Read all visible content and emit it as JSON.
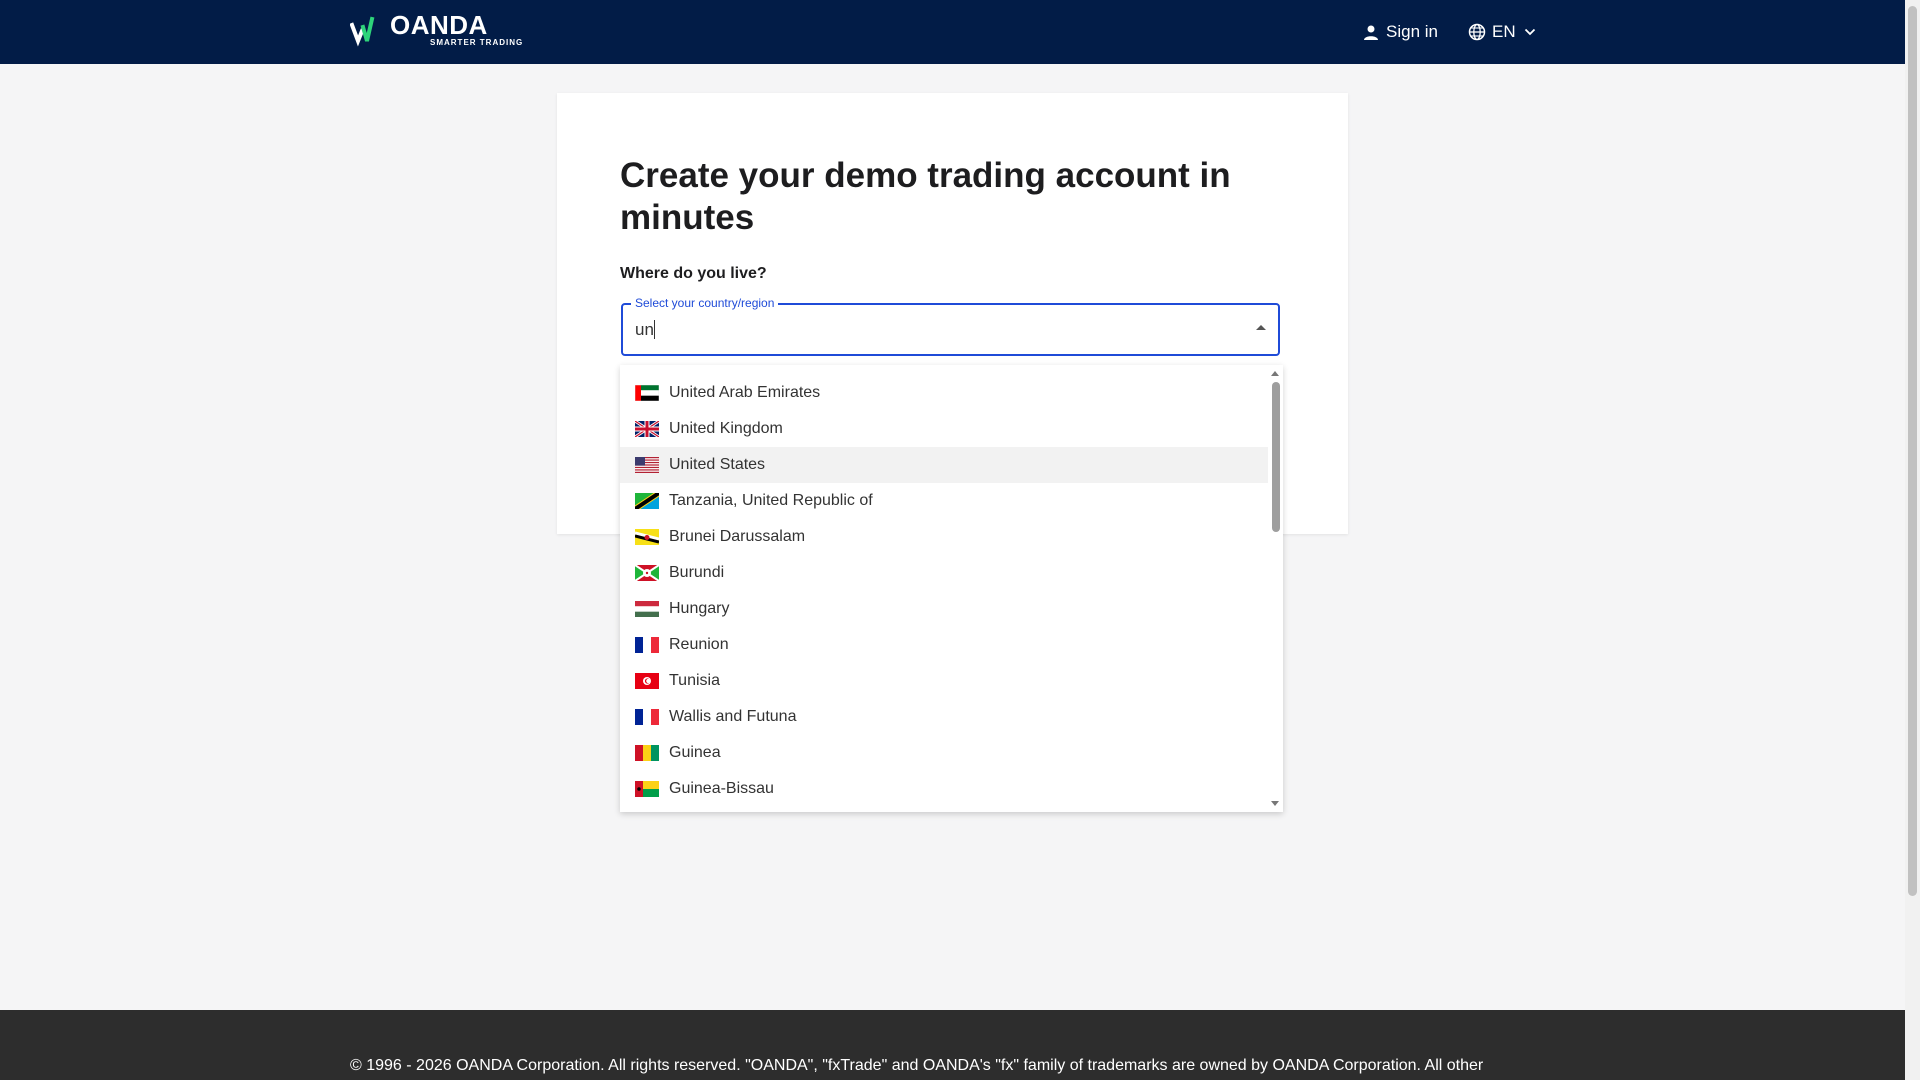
{
  "header": {
    "brand": "OANDA",
    "tagline": "SMARTER TRADING",
    "signin_label": "Sign in",
    "language_label": "EN",
    "background_color": "#021c47",
    "logo_accent_color": "#2ed47a"
  },
  "card": {
    "title": "Create your demo trading account in minutes",
    "question": "Where do you live?",
    "select": {
      "legend": "Select your country/region",
      "value": "un",
      "focus_color": "#1f4bd8"
    }
  },
  "dropdown": {
    "options": [
      {
        "label": "United Arab Emirates",
        "flag": "ae-flag-icon"
      },
      {
        "label": "United Kingdom",
        "flag": "gb-flag-icon"
      },
      {
        "label": "United States",
        "flag": "us-flag-icon",
        "highlighted": true
      },
      {
        "label": "Tanzania, United Republic of",
        "flag": "tz-flag-icon"
      },
      {
        "label": "Brunei Darussalam",
        "flag": "bn-flag-icon"
      },
      {
        "label": "Burundi",
        "flag": "bi-flag-icon"
      },
      {
        "label": "Hungary",
        "flag": "hu-flag-icon"
      },
      {
        "label": "Reunion",
        "flag": "re-flag-icon"
      },
      {
        "label": "Tunisia",
        "flag": "tn-flag-icon"
      },
      {
        "label": "Wallis and Futuna",
        "flag": "wf-flag-icon"
      },
      {
        "label": "Guinea",
        "flag": "gn-flag-icon"
      },
      {
        "label": "Guinea-Bissau",
        "flag": "gw-flag-icon"
      }
    ]
  },
  "footer": {
    "text": "© 1996 - 2026 OANDA Corporation. All rights reserved. \"OANDA\", \"fxTrade\" and OANDA's \"fx\" family of trademarks are owned by OANDA Corporation. All other"
  }
}
